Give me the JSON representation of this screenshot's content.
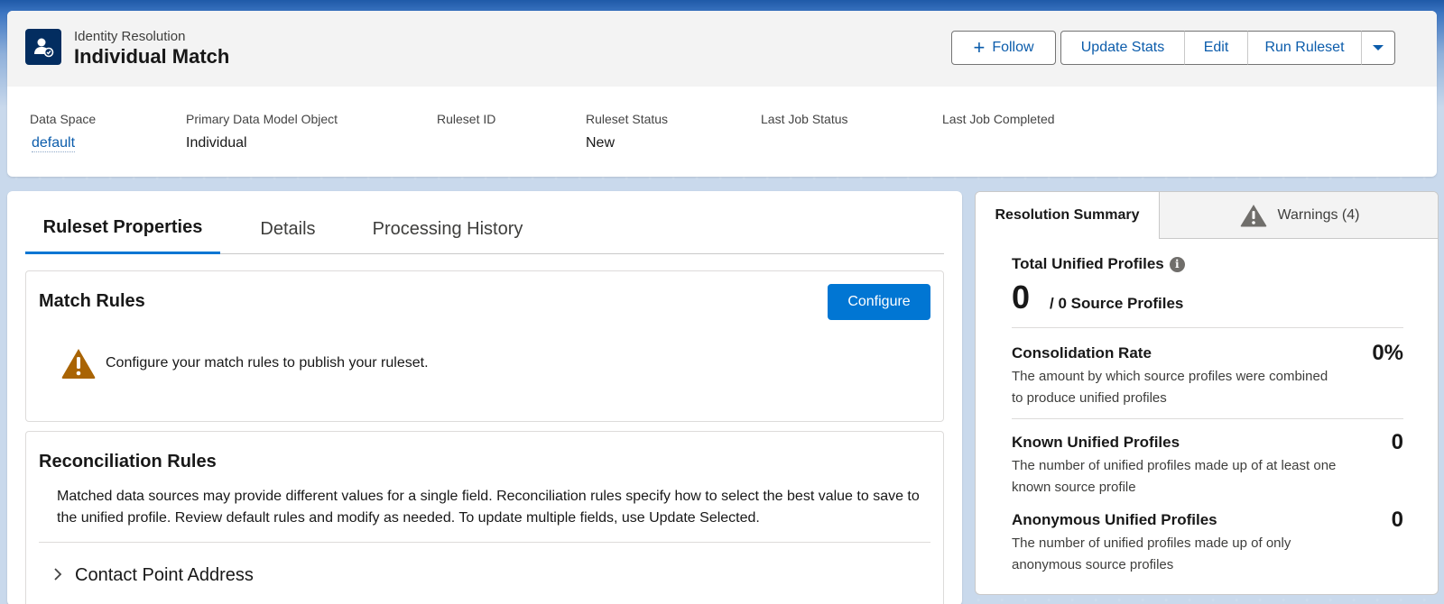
{
  "header": {
    "subtitle": "Identity Resolution",
    "title": "Individual Match",
    "icon": "identity-resolution-icon",
    "actions": {
      "follow_label": "Follow",
      "update_stats_label": "Update Stats",
      "edit_label": "Edit",
      "run_ruleset_label": "Run Ruleset"
    },
    "fields": [
      {
        "label": "Data Space",
        "value": "default"
      },
      {
        "label": "Primary Data Model Object",
        "value": "Individual"
      },
      {
        "label": "Ruleset ID",
        "value": ""
      },
      {
        "label": "Ruleset Status",
        "value": "New"
      },
      {
        "label": "Last Job Status",
        "value": ""
      },
      {
        "label": "Last Job Completed",
        "value": ""
      }
    ]
  },
  "main": {
    "tabs": [
      {
        "label": "Ruleset Properties"
      },
      {
        "label": "Details"
      },
      {
        "label": "Processing History"
      }
    ],
    "match_rules": {
      "title": "Match Rules",
      "configure_label": "Configure",
      "warning": "Configure your match rules to publish your ruleset."
    },
    "reconciliation_rules": {
      "title": "Reconciliation Rules",
      "description": "Matched data sources may provide different values for a single field. Reconciliation rules specify how to select the best value to save to the unified profile. Review default rules and modify as needed. To update multiple fields, use Update Selected.",
      "items": [
        {
          "label": "Contact Point Address"
        }
      ]
    }
  },
  "sidebar": {
    "tabs": [
      {
        "label": "Resolution Summary"
      },
      {
        "label": "Warnings (4)"
      }
    ],
    "summary": {
      "total_title": "Total Unified Profiles",
      "total_value": "0",
      "source_text": "/ 0 Source Profiles",
      "metrics": [
        {
          "title": "Consolidation Rate",
          "desc": "The amount by which source profiles were combined to produce unified profiles",
          "value": "0%"
        },
        {
          "title": "Known Unified Profiles",
          "desc": "The number of unified profiles made up of at least one known source profile",
          "value": "0"
        },
        {
          "title": "Anonymous Unified Profiles",
          "desc": "The number of unified profiles made up of only anonymous source profiles",
          "value": "0"
        }
      ]
    }
  },
  "colors": {
    "brand_blue": "#0176d3",
    "link_blue": "#0b5cab",
    "header_icon_bg": "#032d60",
    "warning_orange": "#a96404"
  }
}
